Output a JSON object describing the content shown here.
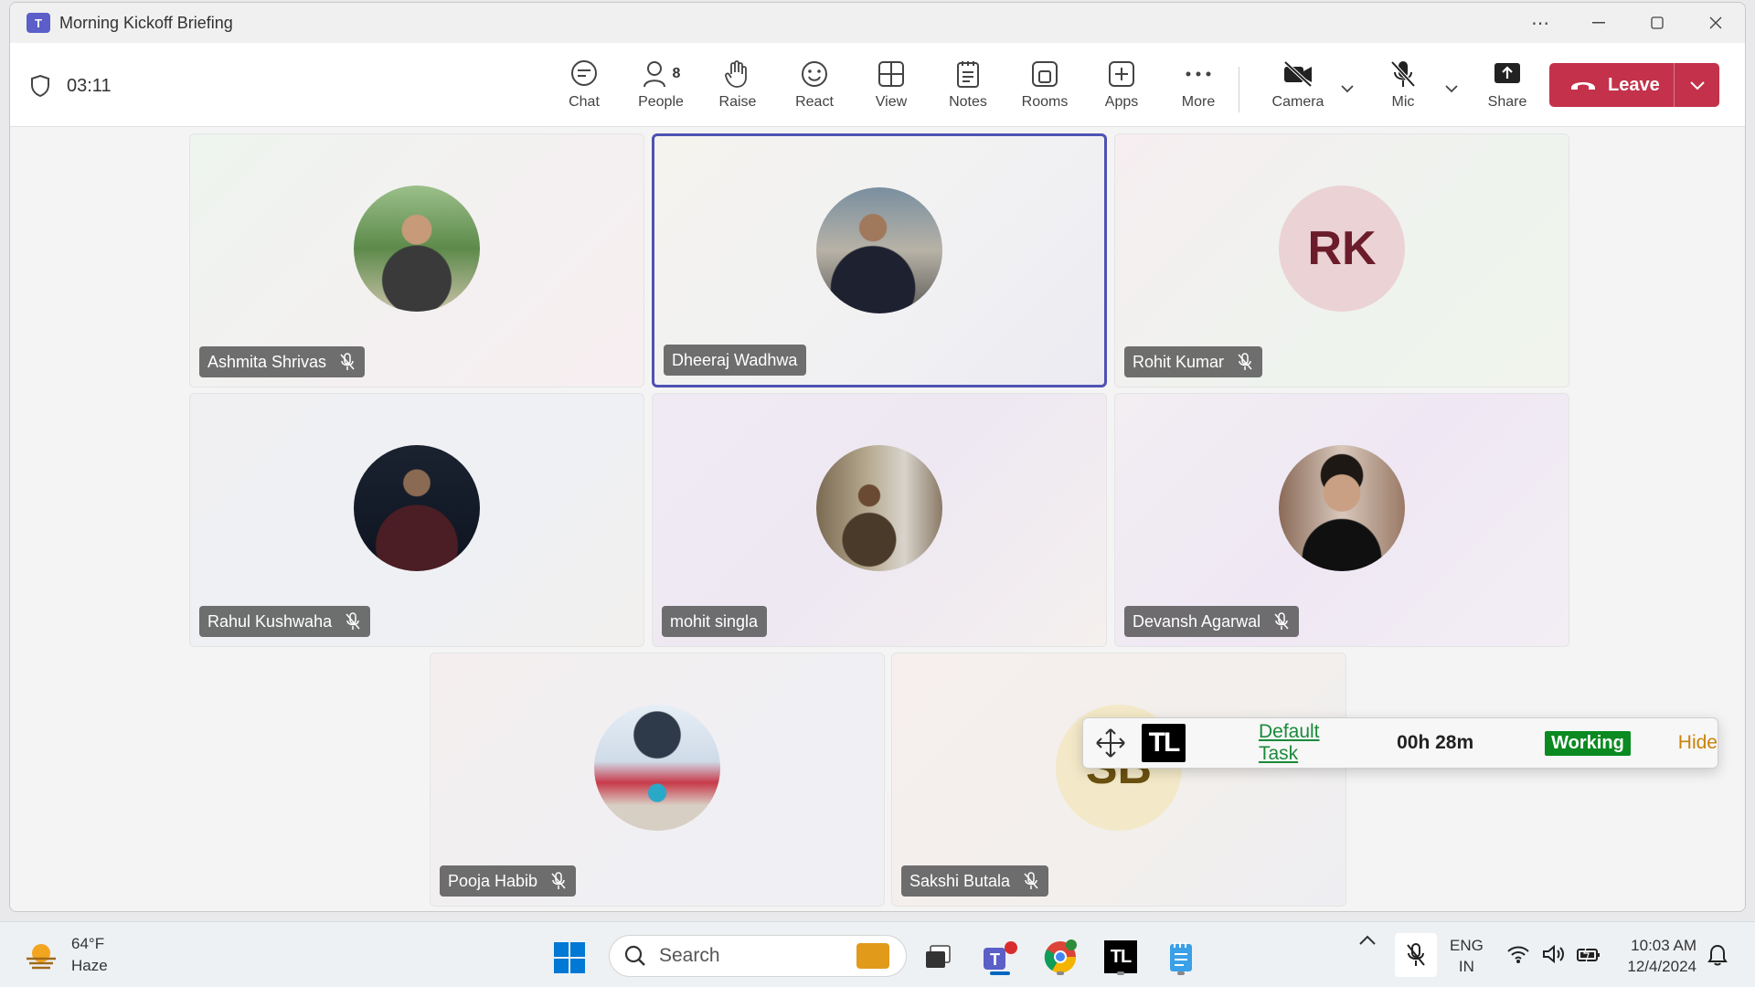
{
  "window": {
    "title": "Morning Kickoff Briefing"
  },
  "toolbar": {
    "timer": "03:11",
    "people_count": "8",
    "items": [
      {
        "label": "Chat"
      },
      {
        "label": "People"
      },
      {
        "label": "Raise"
      },
      {
        "label": "React"
      },
      {
        "label": "View"
      },
      {
        "label": "Notes"
      },
      {
        "label": "Rooms"
      },
      {
        "label": "Apps"
      },
      {
        "label": "More"
      },
      {
        "label": "Camera"
      },
      {
        "label": "Mic"
      },
      {
        "label": "Share"
      }
    ],
    "leave_label": "Leave",
    "leave_color": "#c4314b"
  },
  "participants": [
    {
      "name": "Ashmita Shrivas",
      "muted": true
    },
    {
      "name": "Dheeraj Wadhwa",
      "muted": false,
      "active_speaker": true
    },
    {
      "name": "Rohit Kumar",
      "muted": true,
      "initials": "RK"
    },
    {
      "name": "Rahul Kushwaha",
      "muted": true
    },
    {
      "name": "mohit singla",
      "muted": false
    },
    {
      "name": "Devansh Agarwal",
      "muted": true
    },
    {
      "name": "Pooja Habib",
      "muted": true
    },
    {
      "name": "Sakshi Butala",
      "muted": true,
      "initials": "SB"
    }
  ],
  "tl_widget": {
    "logo": "TL",
    "task": "Default Task",
    "time": "00h 28m",
    "status": "Working",
    "hide": "Hide"
  },
  "taskbar": {
    "weather_temp": "64°F",
    "weather_desc": "Haze",
    "search_placeholder": "Search",
    "tl_app": "TL",
    "lang_top": "ENG",
    "lang_bottom": "IN",
    "time": "10:03 AM",
    "date": "12/4/2024"
  }
}
